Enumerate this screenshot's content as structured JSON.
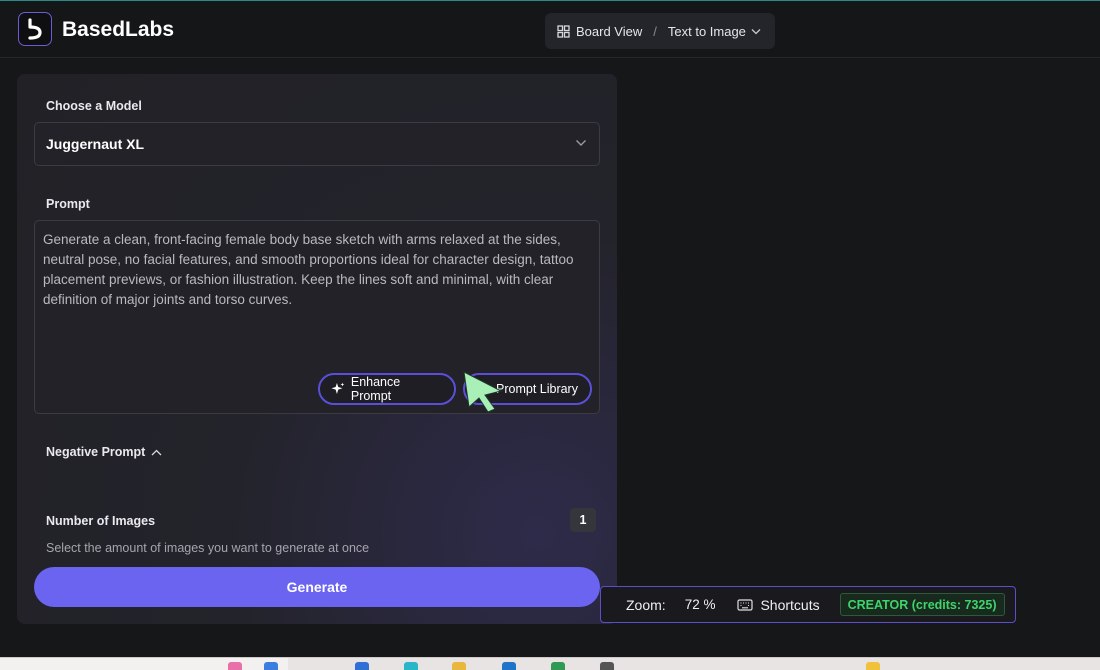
{
  "app": {
    "brand": "BasedLabs"
  },
  "breadcrumb": {
    "board_view": "Board View",
    "separator": "/",
    "current": "Text to Image"
  },
  "panel": {
    "model_label": "Choose a Model",
    "model_value": "Juggernaut XL",
    "prompt_label": "Prompt",
    "prompt_text": "Generate a clean, front-facing female body base sketch with arms relaxed at the sides, neutral pose, no facial features, and smooth proportions ideal for character design, tattoo placement previews, or fashion illustration. Keep the lines soft and minimal, with clear definition of major joints and torso curves.",
    "enhance_label": "Enhance Prompt",
    "library_label": "Prompt Library",
    "negative_label": "Negative Prompt",
    "num_images_label": "Number of Images",
    "num_images_value": "1",
    "num_images_help": "Select the amount of images you want to generate at once",
    "generate_label": "Generate"
  },
  "status": {
    "zoom_label": "Zoom:",
    "zoom_value": "72 %",
    "shortcuts_label": "Shortcuts",
    "credits_label": "CREATOR (credits: 7325)"
  },
  "colors": {
    "accent": "#6a64f1",
    "pill_border": "#5b4fd9",
    "credits_green": "#3fd46a",
    "cursor_green": "#a8f0b8"
  },
  "icons": [
    "logo-icon",
    "grid-icon",
    "chevron-down-icon",
    "sparkle-icon",
    "library-icon",
    "chevron-up-icon",
    "keyboard-icon",
    "cursor-arrow-icon"
  ]
}
